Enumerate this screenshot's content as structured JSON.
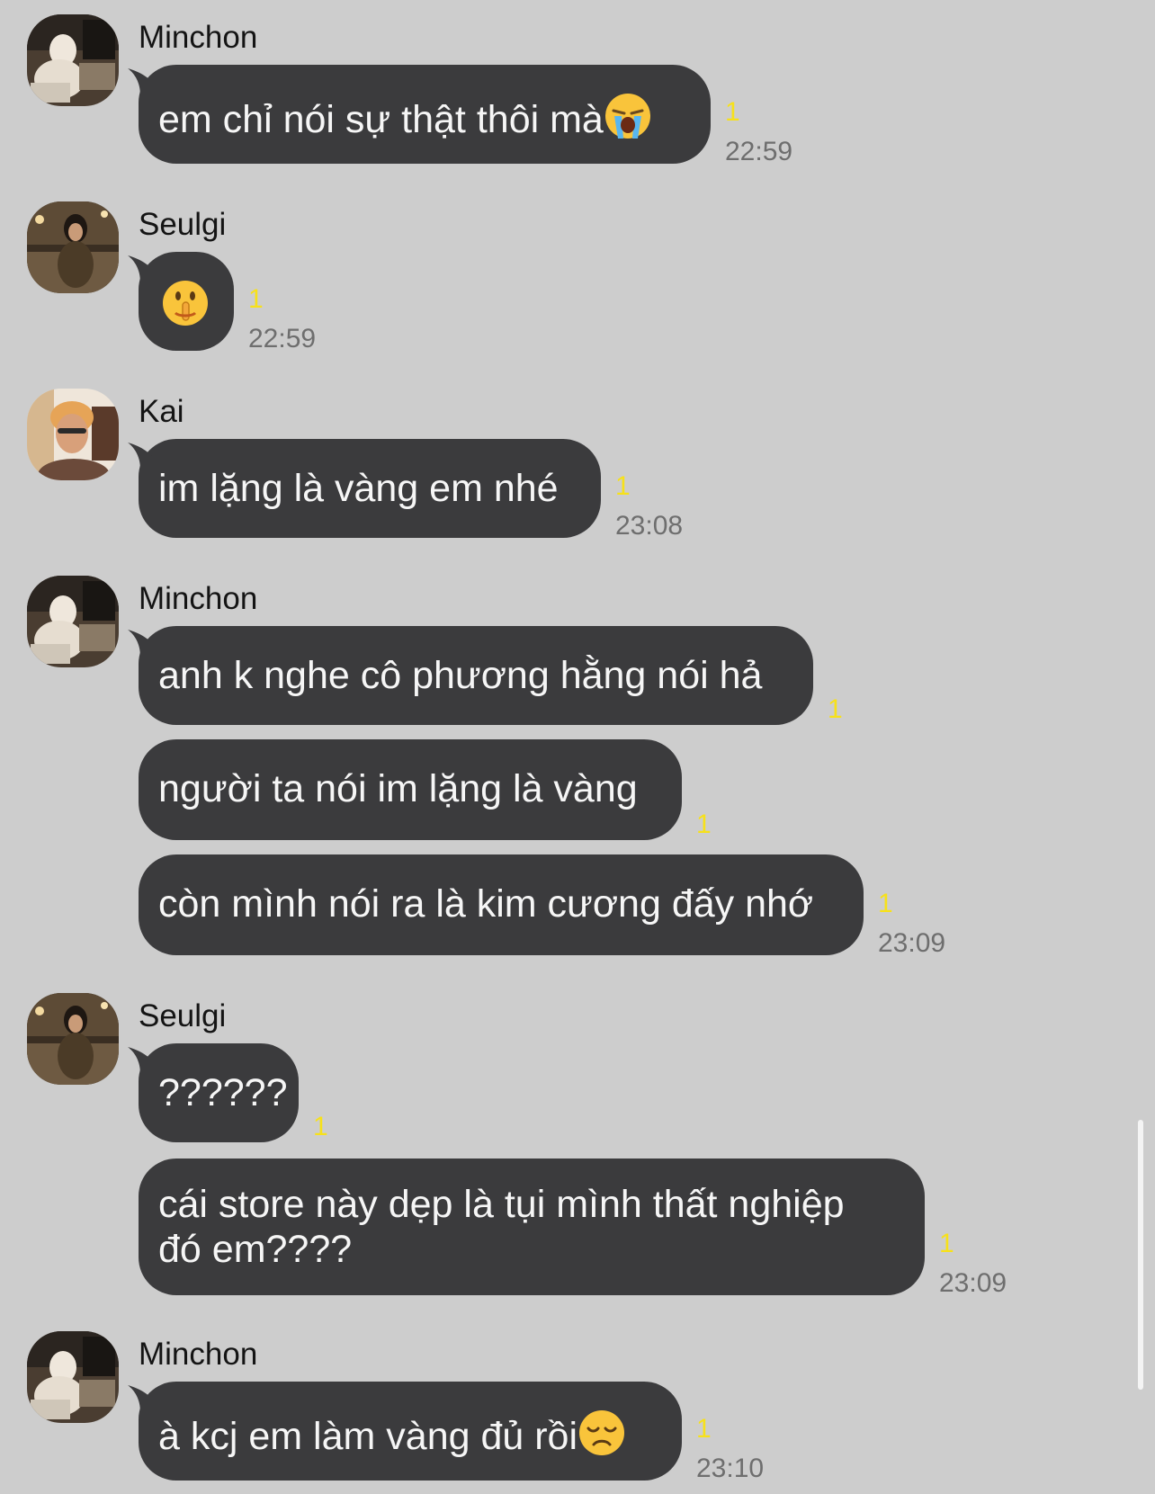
{
  "groups": [
    {
      "sender": "Minchon",
      "avatar": "minchon-avatar",
      "messages": [
        {
          "text": "em chỉ nói sự thật thôi mà",
          "emoji": "loudly-crying-face",
          "unread": "1",
          "time": "22:59"
        }
      ]
    },
    {
      "sender": "Seulgi",
      "avatar": "seulgi-avatar",
      "messages": [
        {
          "text": "",
          "emoji": "shushing-face",
          "unread": "1",
          "time": "22:59"
        }
      ]
    },
    {
      "sender": "Kai",
      "avatar": "kai-avatar",
      "messages": [
        {
          "text": "im lặng là vàng em nhé",
          "unread": "1",
          "time": "23:08"
        }
      ]
    },
    {
      "sender": "Minchon",
      "avatar": "minchon-avatar",
      "messages": [
        {
          "text": "anh k nghe cô phương hằng nói hả",
          "unread": "1"
        },
        {
          "text": "người ta nói im lặng là vàng",
          "unread": "1"
        },
        {
          "text": "còn mình nói ra là kim cương đấy nhớ",
          "unread": "1",
          "time": "23:09"
        }
      ]
    },
    {
      "sender": "Seulgi",
      "avatar": "seulgi-avatar",
      "messages": [
        {
          "text": "??????",
          "unread": "1"
        },
        {
          "line1": "cái store này dẹp là tụi mình thất nghiệp",
          "line2": "đó em????",
          "unread": "1",
          "time": "23:09"
        }
      ]
    },
    {
      "sender": "Minchon",
      "avatar": "minchon-avatar",
      "messages": [
        {
          "text": "à kcj em làm vàng đủ rồi",
          "emoji": "disappointed-face",
          "unread": "1",
          "time": "23:10"
        }
      ]
    }
  ],
  "colors": {
    "background": "#cdcdcd",
    "bubble": "#3b3b3d",
    "bubble_text": "#f6f6f6",
    "unread": "#f7e11a",
    "time": "#6e6e6e"
  }
}
